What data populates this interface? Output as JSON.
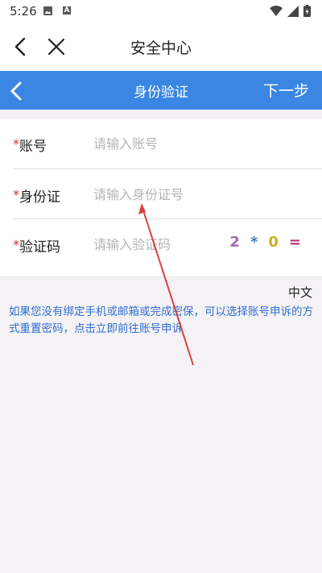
{
  "status_bar": {
    "time": "5:26",
    "notification_badge": "A"
  },
  "nav": {
    "title": "安全中心"
  },
  "blue_bar": {
    "title": "身份验证",
    "next": "下一步"
  },
  "form": {
    "required_mark": "*",
    "account": {
      "label": "账号",
      "placeholder": "请输入账号"
    },
    "id_card": {
      "label": "身份证",
      "placeholder": "请输入身份证号"
    },
    "captcha": {
      "label": "验证码",
      "placeholder": "请输入验证码",
      "chars": [
        {
          "text": "2",
          "color": "#a868b8"
        },
        {
          "text": "*",
          "color": "#4a78b0"
        },
        {
          "text": "0",
          "color": "#c8b020"
        },
        {
          "text": "=",
          "color": "#b03070"
        }
      ]
    }
  },
  "language": "中文",
  "hint": {
    "text": "如果您没有绑定手机或邮箱或完成密保，可以选择账号申诉的方式重置密码，",
    "link": "点击立即前往账号申诉"
  },
  "colors": {
    "header_blue": "#3a86e2",
    "link_blue": "#2f6fd0",
    "required_red": "#d03030",
    "annotation_arrow": "#d94040"
  }
}
